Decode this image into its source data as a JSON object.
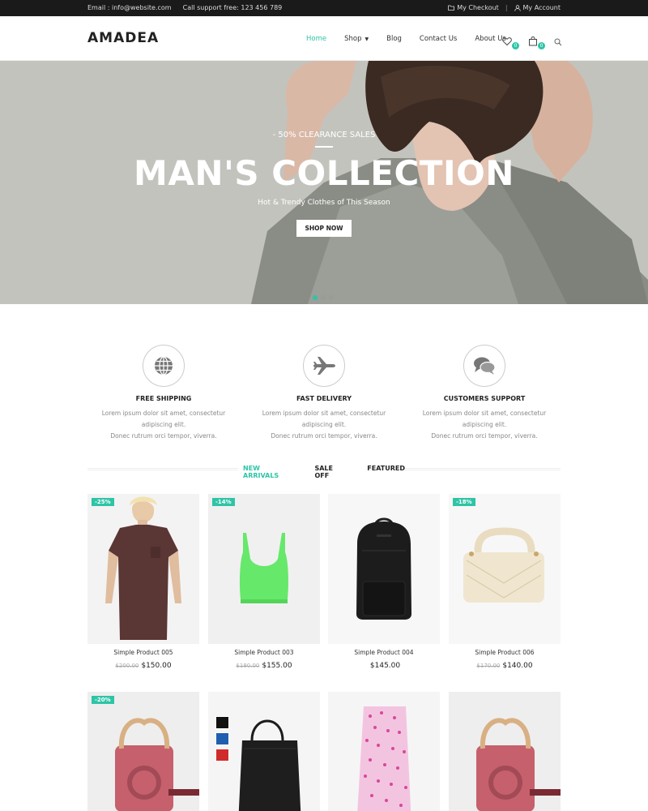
{
  "topbar": {
    "email": "Email : info@website.com",
    "support": "Call support free: 123 456 789",
    "checkout": "My Checkout",
    "separator": "|",
    "account": "My Account"
  },
  "header": {
    "logo": "AMADEA",
    "nav": [
      "Home",
      "Shop",
      "Blog",
      "Contact Us",
      "About Us"
    ],
    "wishlist_count": "0",
    "cart_count": "0"
  },
  "hero": {
    "subtitle": "- 50% CLEARANCE SALES",
    "title": "MAN'S COLLECTION",
    "tagline": "Hot & Trendy Clothes of This Season",
    "button": "SHOP NOW"
  },
  "features": [
    {
      "icon": "globe-icon",
      "title": "FREE SHIPPING",
      "desc1": "Lorem ipsum dolor sit amet, consectetur adipiscing elit.",
      "desc2": "Donec rutrum orci tempor, viverra."
    },
    {
      "icon": "airplane-icon",
      "title": "FAST DELIVERY",
      "desc1": "Lorem ipsum dolor sit amet, consectetur adipiscing elit.",
      "desc2": "Donec rutrum orci tempor, viverra."
    },
    {
      "icon": "chat-icon",
      "title": "CUSTOMERS SUPPORT",
      "desc1": "Lorem ipsum dolor sit amet, consectetur adipiscing elit.",
      "desc2": "Donec rutrum orci tempor, viverra."
    }
  ],
  "tabs": [
    "NEW ARRIVALS",
    "SALE OFF",
    "FEATURED"
  ],
  "products": [
    {
      "name": "Simple Product 005",
      "discount": "-25%",
      "old_price": "$200.00",
      "price": "$150.00"
    },
    {
      "name": "Simple Product 003",
      "discount": "-14%",
      "old_price": "$180.00",
      "price": "$155.00"
    },
    {
      "name": "Simple Product 004",
      "discount": "",
      "old_price": "",
      "price": "$145.00"
    },
    {
      "name": "Simple Product 006",
      "discount": "-18%",
      "old_price": "$170.00",
      "price": "$140.00"
    },
    {
      "name": "",
      "discount": "-20%",
      "old_price": "",
      "price": ""
    },
    {
      "name": "",
      "discount": "",
      "old_price": "",
      "price": ""
    },
    {
      "name": "",
      "discount": "",
      "old_price": "",
      "price": ""
    },
    {
      "name": "",
      "discount": "",
      "old_price": "",
      "price": ""
    }
  ],
  "colors": {
    "accent": "#2ec4a6",
    "topbar": "#1a1a1a",
    "swatches": [
      "#111111",
      "#1e5fb0",
      "#d02b2b"
    ]
  }
}
